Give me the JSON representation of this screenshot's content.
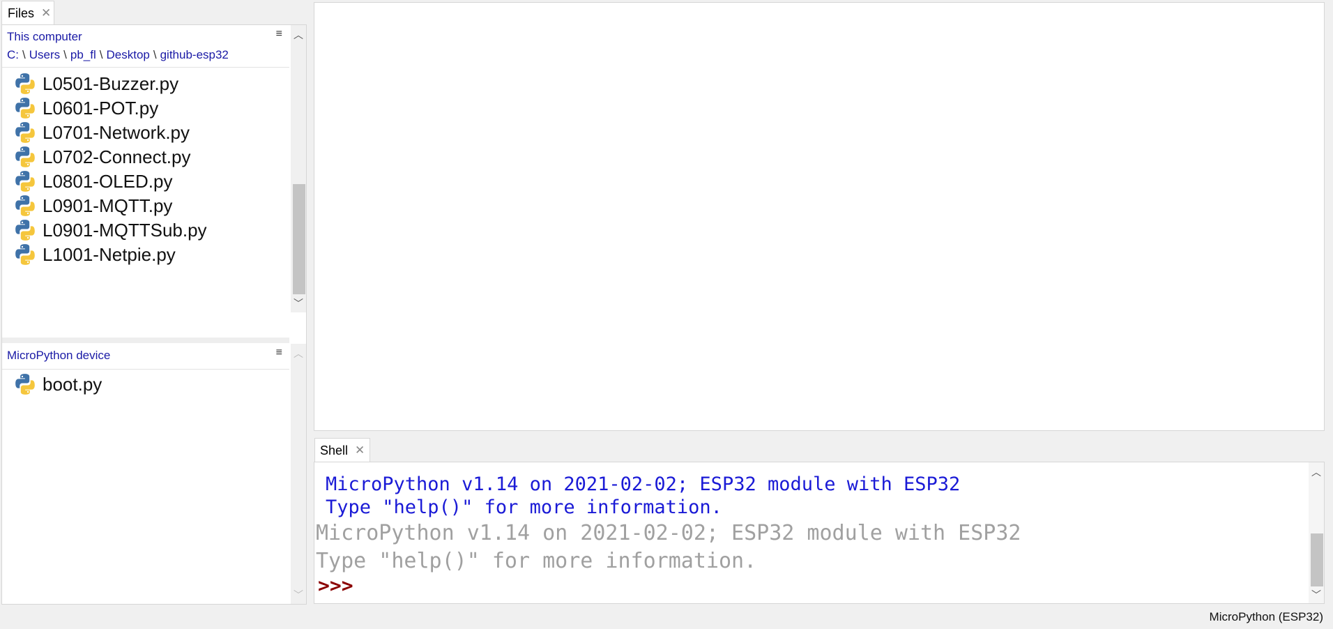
{
  "files_panel": {
    "tab_label": "Files",
    "close_glyph": "✕",
    "computer": {
      "title": "This computer",
      "menu_glyph": "≡",
      "path": [
        "C:",
        "Users",
        "pb_fl",
        "Desktop",
        "github-esp32"
      ],
      "path_separator": "\\",
      "files": [
        "L0501-Buzzer.py",
        "L0601-POT.py",
        "L0701-Network.py",
        "L0702-Connect.py",
        "L0801-OLED.py",
        "L0901-MQTT.py",
        "L0901-MQTTSub.py",
        "L1001-Netpie.py"
      ]
    },
    "device": {
      "title": "MicroPython device",
      "menu_glyph": "≡",
      "files": [
        "boot.py"
      ]
    },
    "icon": "python-file-icon"
  },
  "shell": {
    "tab_label": "Shell",
    "close_glyph": "✕",
    "lines_blue": [
      "MicroPython v1.14 on 2021-02-02; ESP32 module with ESP32",
      "Type \"help()\" for more information."
    ],
    "lines_gray": [
      "MicroPython v1.14 on 2021-02-02; ESP32 module with ESP32",
      "Type \"help()\" for more information."
    ],
    "prompt": ">>>"
  },
  "status_bar": {
    "interpreter": "MicroPython (ESP32)"
  },
  "colors": {
    "link_blue": "#1a1aa6",
    "shell_blue": "#1a1ad6",
    "shell_gray": "#a0a0a0",
    "prompt_red": "#8b0000"
  }
}
